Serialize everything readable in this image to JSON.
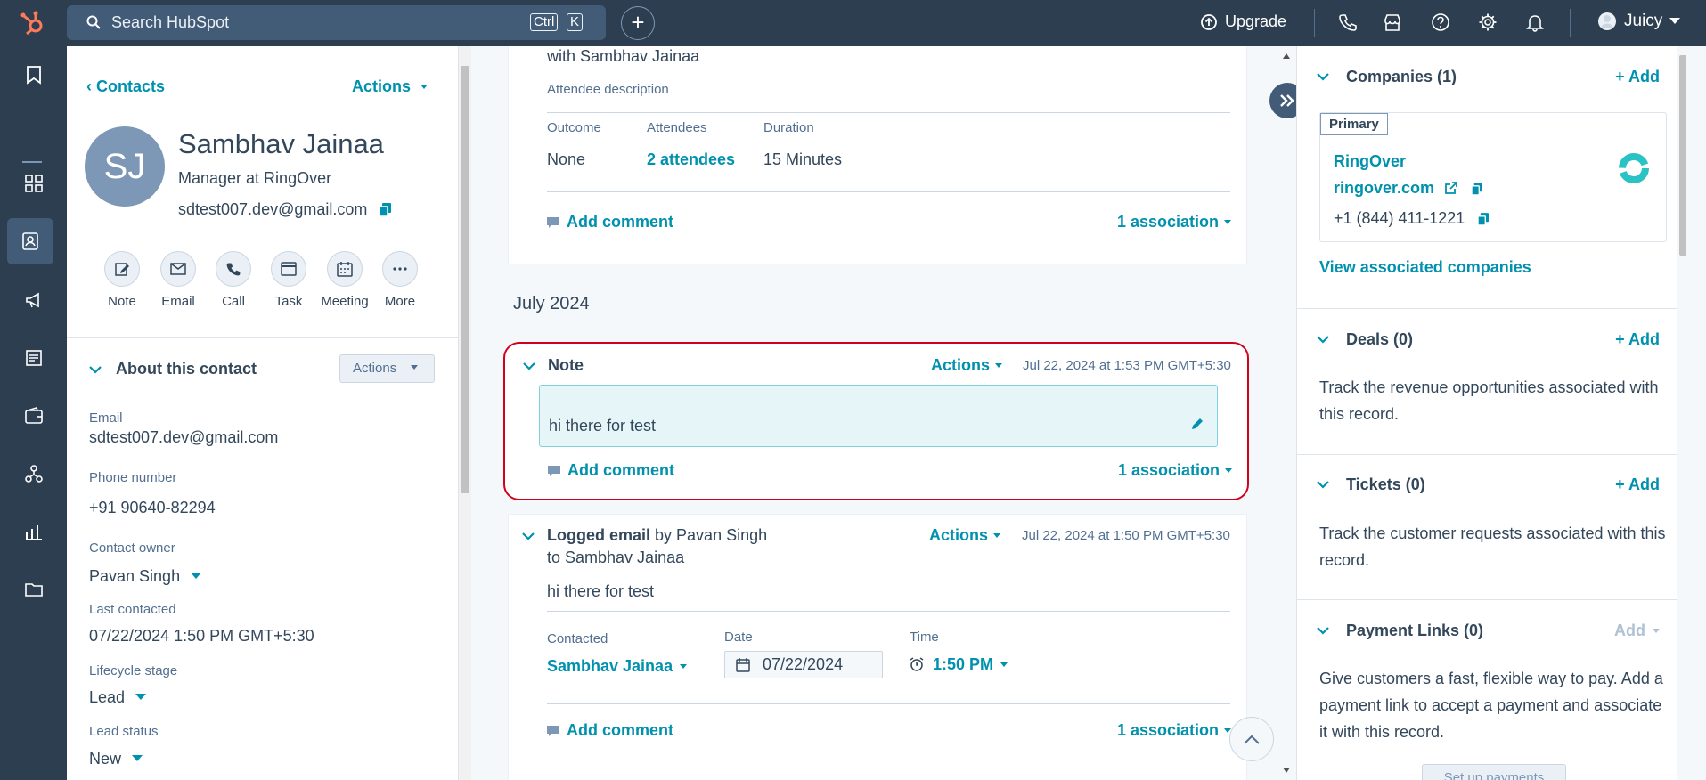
{
  "topbar": {
    "search_placeholder": "Search HubSpot",
    "shortcut_ctrl": "Ctrl",
    "shortcut_k": "K",
    "plus_label": "+",
    "upgrade_label": "Upgrade",
    "user_name": "Juicy"
  },
  "contact": {
    "back_label": "Contacts",
    "actions_label": "Actions",
    "initials": "SJ",
    "name": "Sambhav Jainaa",
    "title": "Manager at RingOver",
    "email": "sdtest007.dev@gmail.com",
    "quick_actions": [
      "Note",
      "Email",
      "Call",
      "Task",
      "Meeting",
      "More"
    ]
  },
  "about": {
    "title": "About this contact",
    "actions_label": "Actions",
    "email_label": "Email",
    "email_value": "sdtest007.dev@gmail.com",
    "phone_label": "Phone number",
    "phone_value": "+91 90640-82294",
    "owner_label": "Contact owner",
    "owner_value": "Pavan Singh",
    "last_contacted_label": "Last contacted",
    "last_contacted_value": "07/22/2024 1:50 PM GMT+5:30",
    "lifecycle_label": "Lifecycle stage",
    "lifecycle_value": "Lead",
    "lead_status_label": "Lead status",
    "lead_status_value": "New"
  },
  "timeline": {
    "meeting": {
      "with_text": "with Sambhav Jainaa",
      "attendee_desc_label": "Attendee description",
      "outcome_label": "Outcome",
      "outcome_value": "None",
      "attendees_label": "Attendees",
      "attendees_value": "2 attendees",
      "duration_label": "Duration",
      "duration_value": "15 Minutes",
      "add_comment": "Add comment",
      "association": "1 association"
    },
    "month": "July 2024",
    "note": {
      "title": "Note",
      "actions_label": "Actions",
      "timestamp": "Jul 22, 2024 at 1:53 PM GMT+5:30",
      "body": "hi there for test",
      "add_comment": "Add comment",
      "association": "1 association"
    },
    "email": {
      "title": "Logged email",
      "by_text": "by Pavan Singh",
      "to_text": "to Sambhav Jainaa",
      "actions_label": "Actions",
      "timestamp": "Jul 22, 2024 at 1:50 PM GMT+5:30",
      "body": "hi there for test",
      "contacted_label": "Contacted",
      "contacted_value": "Sambhav Jainaa",
      "date_label": "Date",
      "date_value": "07/22/2024",
      "time_label": "Time",
      "time_value": "1:50 PM",
      "add_comment": "Add comment",
      "association": "1 association"
    }
  },
  "right": {
    "companies_title": "Companies (1)",
    "add_label": "+ Add",
    "primary_tag": "Primary",
    "company_name": "RingOver",
    "company_domain": "ringover.com",
    "company_phone": "+1 (844) 411-1221",
    "view_companies": "View associated companies",
    "deals_title": "Deals (0)",
    "deals_text": "Track the revenue opportunities associated with this record.",
    "tickets_title": "Tickets (0)",
    "tickets_text": "Track the customer requests associated with this record.",
    "payment_title": "Payment Links (0)",
    "payment_add": "Add",
    "payment_text": "Give customers a fast, flexible way to pay. Add a payment link to accept a payment and associate it with this record.",
    "payment_button": "Set up payments"
  },
  "colors": {
    "brand_orange": "#ff7a59",
    "link_teal": "#0091ae",
    "nav_dark": "#2d3e50",
    "highlight_red": "#d0021b"
  }
}
